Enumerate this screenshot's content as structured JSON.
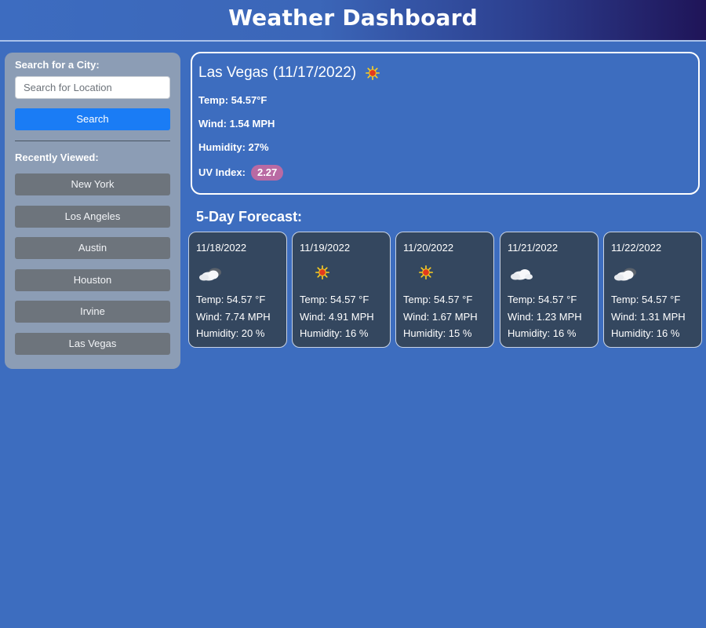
{
  "app": {
    "title": "Weather Dashboard"
  },
  "sidebar": {
    "search_label": "Search for a City:",
    "search_placeholder": "Search for Location",
    "search_value": "",
    "search_button": "Search",
    "recent_label": "Recently Viewed:",
    "recent": [
      {
        "label": "New York"
      },
      {
        "label": "Los Angeles"
      },
      {
        "label": "Austin"
      },
      {
        "label": "Houston"
      },
      {
        "label": "Irvine"
      },
      {
        "label": "Las Vegas"
      }
    ]
  },
  "current": {
    "city": "Las Vegas",
    "date": "(11/17/2022)",
    "icon": "sun-icon",
    "temp": "Temp: 54.57°F",
    "wind": "Wind: 1.54 MPH",
    "humidity": "Humidity: 27%",
    "uv_label": "UV Index:",
    "uv_value": "2.27",
    "uv_color": "#b96aa3"
  },
  "forecast": {
    "title": "5-Day Forecast:",
    "days": [
      {
        "date": "11/18/2022",
        "icon": "cloud-icon",
        "temp": "Temp: 54.57 °F",
        "wind": "Wind: 7.74 MPH",
        "humidity": "Humidity: 20 %"
      },
      {
        "date": "11/19/2022",
        "icon": "sun-icon",
        "temp": "Temp: 54.57 °F",
        "wind": "Wind: 4.91 MPH",
        "humidity": "Humidity: 16 %"
      },
      {
        "date": "11/20/2022",
        "icon": "sun-icon",
        "temp": "Temp: 54.57 °F",
        "wind": "Wind: 1.67 MPH",
        "humidity": "Humidity: 15 %"
      },
      {
        "date": "11/21/2022",
        "icon": "cloud-icon",
        "temp": "Temp: 54.57 °F",
        "wind": "Wind: 1.23 MPH",
        "humidity": "Humidity: 16 %"
      },
      {
        "date": "11/22/2022",
        "icon": "cloud-icon",
        "temp": "Temp: 54.57 °F",
        "wind": "Wind: 1.31 MPH",
        "humidity": "Humidity: 16 %"
      }
    ]
  },
  "colors": {
    "background": "#3d6dbf",
    "search_button": "#1a7cf5",
    "city_button": "#6d747c",
    "card": "#34475f",
    "sidebar": "#8c9db5"
  }
}
